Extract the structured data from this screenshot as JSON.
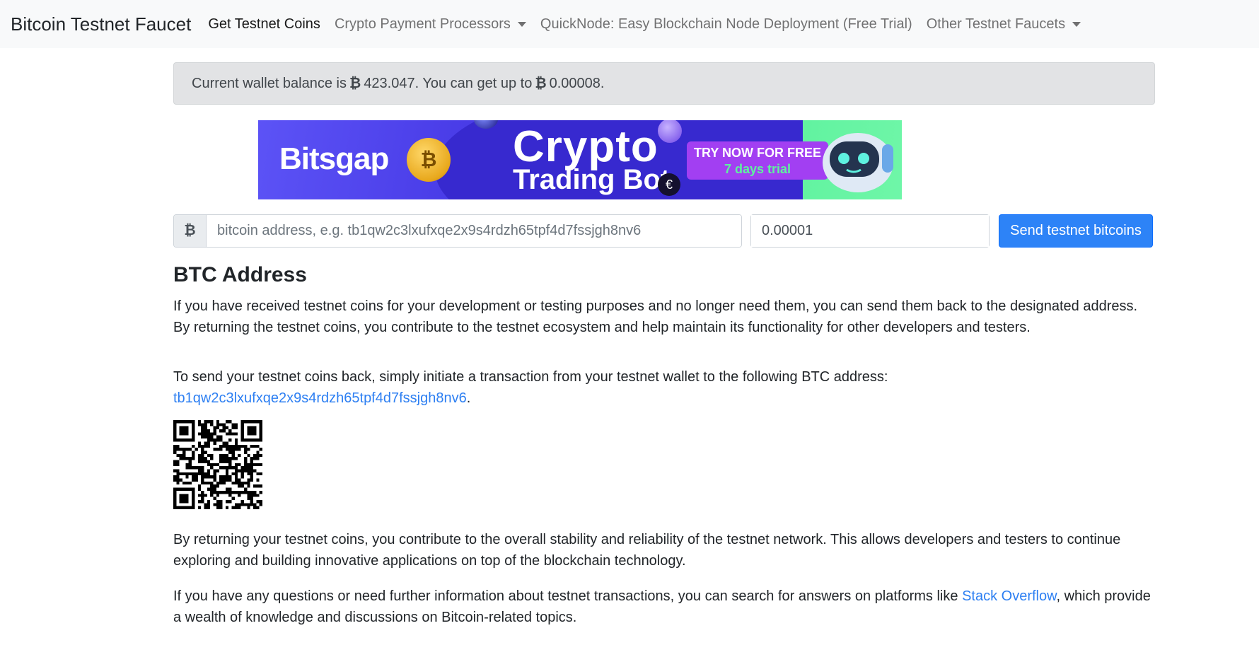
{
  "navbar": {
    "brand": "Bitcoin Testnet Faucet",
    "links": [
      {
        "label": "Get Testnet Coins",
        "active": true,
        "dropdown": false
      },
      {
        "label": "Crypto Payment Processors",
        "active": false,
        "dropdown": true
      },
      {
        "label": "QuickNode: Easy Blockchain Node Deployment (Free Trial)",
        "active": false,
        "dropdown": false
      },
      {
        "label": "Other Testnet Faucets",
        "active": false,
        "dropdown": true
      }
    ]
  },
  "alert": {
    "prefix": "Current wallet balance is",
    "symbol": "₿",
    "balance": "423.047. You can get up to",
    "max_amount": "0.00008."
  },
  "banner": {
    "brand": "Bitsgap",
    "headline": "Crypto",
    "subheadline": "Trading Bot",
    "cta_line1": "TRY NOW FOR FREE",
    "cta_line2": "7 days trial"
  },
  "form": {
    "addon_symbol": "₿",
    "address_placeholder": "bitcoin address, e.g. tb1qw2c3lxufxqe2x9s4rdzh65tpf4d7fssjgh8nv6",
    "amount_value": "0.00001",
    "send_label": "Send testnet bitcoins"
  },
  "content": {
    "heading": "BTC Address",
    "p1": "If you have received testnet coins for your development or testing purposes and no longer need them, you can send them back to the designated address. By returning the testnet coins, you contribute to the testnet ecosystem and help maintain its functionality for other developers and testers.",
    "p2_text": "To send your testnet coins back, simply initiate a transaction from your testnet wallet to the following BTC address:",
    "return_address": "tb1qw2c3lxufxqe2x9s4rdzh65tpf4d7fssjgh8nv6",
    "p2_end": ".",
    "p3": "By returning your testnet coins, you contribute to the overall stability and reliability of the testnet network. This allows developers and testers to continue exploring and building innovative applications on top of the blockchain technology.",
    "p4_start": "If you have any questions or need further information about testnet transactions, you can search for answers on platforms like",
    "p4_link": "Stack Overflow",
    "p4_end": ", which provide a wealth of knowledge and discussions on Bitcoin-related topics."
  },
  "colors": {
    "navbar_bg": "#f8f9fa",
    "alert_bg": "#e2e3e5",
    "primary": "#2d83f7",
    "link": "#2d7ff2"
  }
}
